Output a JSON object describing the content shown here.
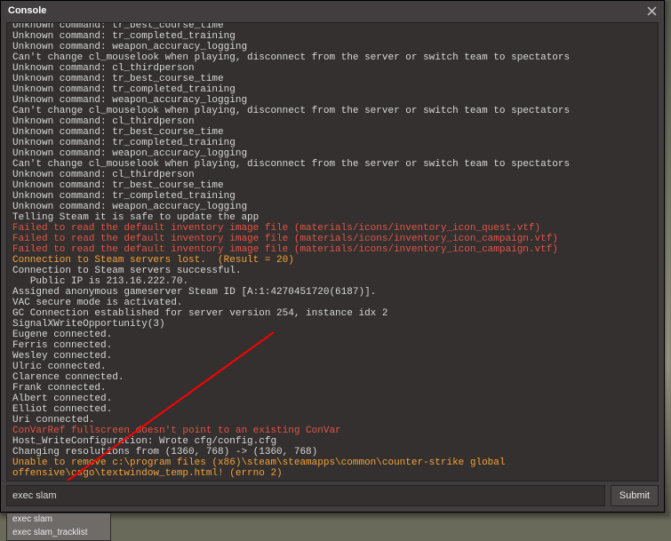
{
  "window": {
    "title": "Console"
  },
  "lines": [
    {
      "color": "white",
      "text": "Unknown command: tr_best_course_time"
    },
    {
      "color": "white",
      "text": "Unknown command: tr_completed_training"
    },
    {
      "color": "white",
      "text": "Unknown command: weapon_accuracy_logging"
    },
    {
      "color": "white",
      "text": "Can't change cl_mouselook when playing, disconnect from the server or switch team to spectators"
    },
    {
      "color": "white",
      "text": "Unknown command: cl_thirdperson"
    },
    {
      "color": "white",
      "text": "Unknown command: tr_best_course_time"
    },
    {
      "color": "white",
      "text": "Unknown command: tr_completed_training"
    },
    {
      "color": "white",
      "text": "Unknown command: weapon_accuracy_logging"
    },
    {
      "color": "white",
      "text": "Can't change cl_mouselook when playing, disconnect from the server or switch team to spectators"
    },
    {
      "color": "white",
      "text": "Unknown command: cl_thirdperson"
    },
    {
      "color": "white",
      "text": "Unknown command: tr_best_course_time"
    },
    {
      "color": "white",
      "text": "Unknown command: tr_completed_training"
    },
    {
      "color": "white",
      "text": "Unknown command: weapon_accuracy_logging"
    },
    {
      "color": "white",
      "text": "Can't change cl_mouselook when playing, disconnect from the server or switch team to spectators"
    },
    {
      "color": "white",
      "text": "Unknown command: cl_thirdperson"
    },
    {
      "color": "white",
      "text": "Unknown command: tr_best_course_time"
    },
    {
      "color": "white",
      "text": "Unknown command: tr_completed_training"
    },
    {
      "color": "white",
      "text": "Unknown command: weapon_accuracy_logging"
    },
    {
      "color": "white",
      "text": "Telling Steam it is safe to update the app"
    },
    {
      "color": "red",
      "text": "Failed to read the default inventory image file (materials/icons/inventory_icon_quest.vtf)"
    },
    {
      "color": "red",
      "text": "Failed to read the default inventory image file (materials/icons/inventory_icon_campaign.vtf)"
    },
    {
      "color": "red",
      "text": "Failed to read the default inventory image file (materials/icons/inventory_icon_campaign.vtf)"
    },
    {
      "color": "orange",
      "text": "Connection to Steam servers lost.  (Result = 20)"
    },
    {
      "color": "white",
      "text": "Connection to Steam servers successful."
    },
    {
      "color": "white",
      "text": "   Public IP is 213.16.222.70."
    },
    {
      "color": "white",
      "text": "Assigned anonymous gameserver Steam ID [A:1:4270451720(6187)]."
    },
    {
      "color": "white",
      "text": "VAC secure mode is activated."
    },
    {
      "color": "white",
      "text": "GC Connection established for server version 254, instance idx 2"
    },
    {
      "color": "white",
      "text": "SignalXWriteOpportunity(3)"
    },
    {
      "color": "white",
      "text": "Eugene connected."
    },
    {
      "color": "white",
      "text": "Ferris connected."
    },
    {
      "color": "white",
      "text": "Wesley connected."
    },
    {
      "color": "white",
      "text": "Ulric connected."
    },
    {
      "color": "white",
      "text": "Clarence connected."
    },
    {
      "color": "white",
      "text": "Frank connected."
    },
    {
      "color": "white",
      "text": "Albert connected."
    },
    {
      "color": "white",
      "text": "Elliot connected."
    },
    {
      "color": "white",
      "text": "Uri connected."
    },
    {
      "color": "red",
      "text": "ConVarRef fullscreen doesn't point to an existing ConVar"
    },
    {
      "color": "white",
      "text": "Host_WriteConfiguration: Wrote cfg/config.cfg"
    },
    {
      "color": "white",
      "text": "Changing resolutions from (1360, 768) -> (1360, 768)"
    },
    {
      "color": "orange",
      "text": "Unable to remove c:\\program files (x86)\\steam\\steamapps\\common\\counter-strike global offensive\\csgo\\textwindow_temp.html! (errno 2)"
    },
    {
      "color": "white",
      "text": ""
    }
  ],
  "input": {
    "value": "exec slam",
    "submit_label": "Submit"
  },
  "autocomplete": [
    "exec slam",
    "exec slam_tracklist"
  ]
}
